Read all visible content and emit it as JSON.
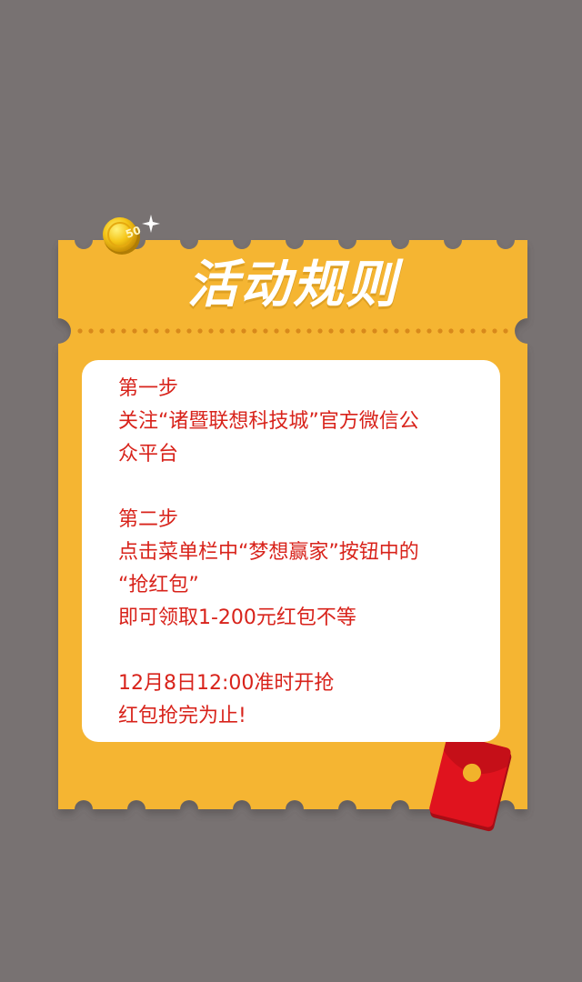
{
  "title": "活动规则",
  "colors": {
    "background": "#787272",
    "ticket": "#f5b531",
    "ticket_shadow": "#d08d1a",
    "rule_text": "#d8231b",
    "panel": "#ffffff",
    "envelope": "#e0131e",
    "envelope_seal": "#f1b32b",
    "coin": "#f5c518"
  },
  "icons": {
    "coin": "gold-coin-icon",
    "sparkle": "sparkle-icon",
    "envelope": "red-envelope-icon"
  },
  "coin_label": "50",
  "rules": {
    "step1": {
      "heading": "第一步",
      "line1": "关注“诸暨联想科技城”官方微信公",
      "line2": "众平台"
    },
    "step2": {
      "heading": "第二步",
      "line1": "点击菜单栏中“梦想赢家”按钮中的",
      "line2": "“抢红包”",
      "line3": "即可领取1-200元红包不等"
    },
    "timing": {
      "line1": "12月8日12:00准时开抢",
      "line2": "红包抢完为止!"
    }
  }
}
